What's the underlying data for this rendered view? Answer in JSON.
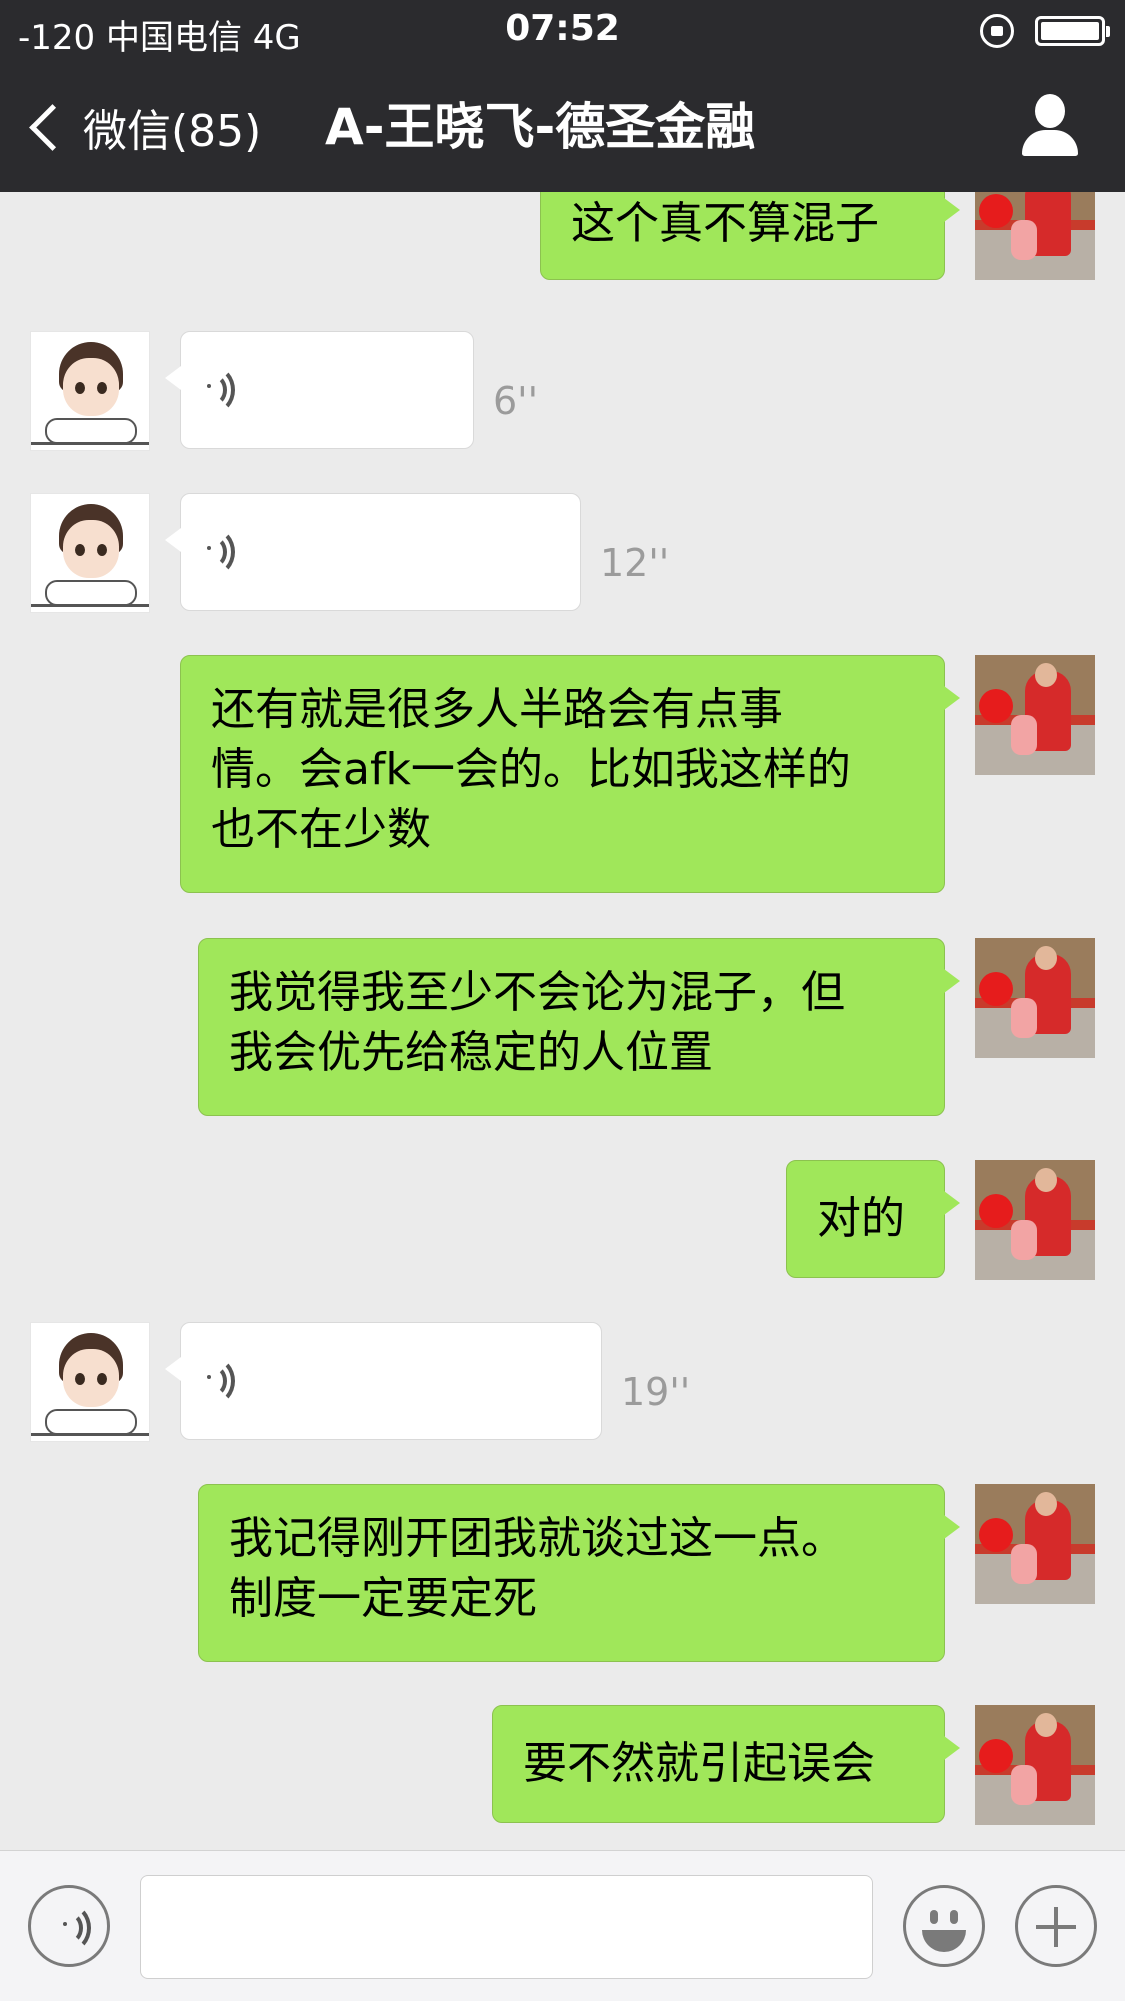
{
  "status_bar": {
    "carrier": "-120 中国电信   4G",
    "time": "07:52"
  },
  "nav": {
    "back_label": "微信(85)",
    "title": "A-王晓飞-德圣金融"
  },
  "messages": [
    {
      "sender": "me",
      "type": "text",
      "text": "这个真不算混子"
    },
    {
      "sender": "them",
      "type": "voice",
      "duration": "6''"
    },
    {
      "sender": "them",
      "type": "voice",
      "duration": "12''"
    },
    {
      "sender": "me",
      "type": "text",
      "lines": [
        "还有就是很多人半路会有点事",
        "情。会afk一会的。比如我这样的",
        "也不在少数"
      ]
    },
    {
      "sender": "me",
      "type": "text",
      "lines": [
        "我觉得我至少不会论为混子，但",
        "我会优先给稳定的人位置"
      ]
    },
    {
      "sender": "me",
      "type": "text",
      "text": "对的"
    },
    {
      "sender": "them",
      "type": "voice",
      "duration": "19''"
    },
    {
      "sender": "me",
      "type": "text",
      "lines": [
        "我记得刚开团我就谈过这一点。",
        "制度一定要定死"
      ]
    },
    {
      "sender": "me",
      "type": "text",
      "text": "要不然就引起误会"
    }
  ],
  "input_bar": {
    "text_value": "",
    "icons": [
      "voice-icon",
      "emoji-icon",
      "plus-icon"
    ]
  },
  "colors": {
    "header_bg": "#2b2b2e",
    "chat_bg": "#ebebeb",
    "my_bubble": "#a0e75a",
    "their_bubble": "#ffffff"
  }
}
